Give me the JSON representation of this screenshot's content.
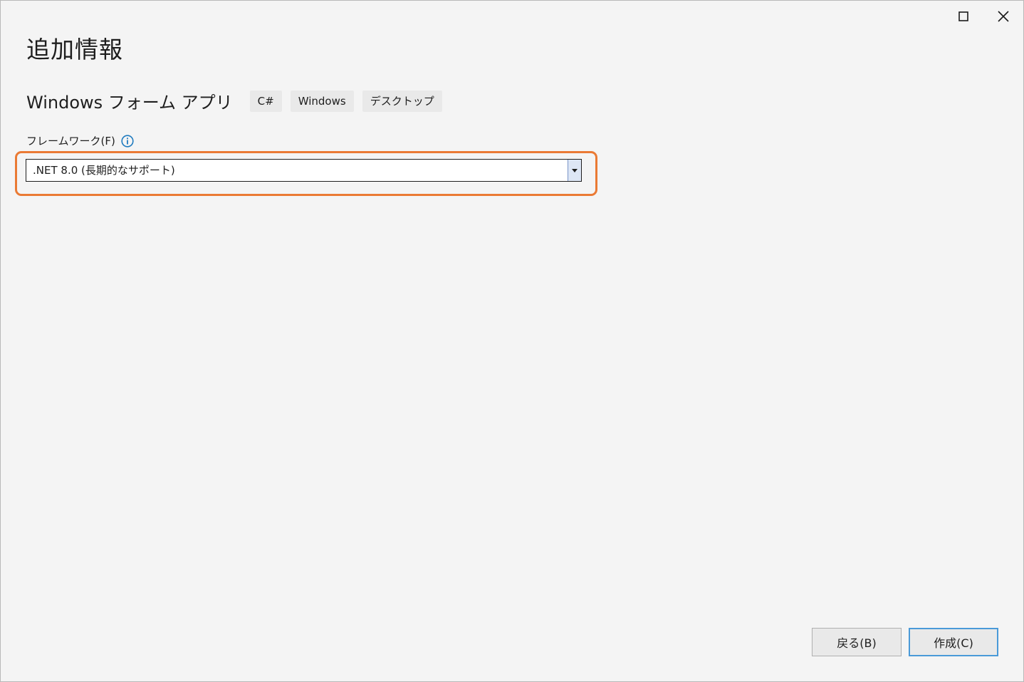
{
  "window": {
    "maximize_icon": "maximize-icon",
    "close_icon": "close-icon"
  },
  "page": {
    "title": "追加情報"
  },
  "project": {
    "name": "Windows フォーム アプリ",
    "tags": [
      "C#",
      "Windows",
      "デスクトップ"
    ]
  },
  "framework": {
    "label": "フレームワーク(F)",
    "info_icon": "info-icon",
    "selected": ".NET 8.0 (長期的なサポート)",
    "dropdown_icon": "chevron-down-icon"
  },
  "footer": {
    "back_label": "戻る(B)",
    "create_label": "作成(C)"
  },
  "colors": {
    "background": "#f4f4f4",
    "highlight": "#ea7a34",
    "info_icon": "#1f7bbf",
    "primary_border": "#4a9ad8"
  }
}
